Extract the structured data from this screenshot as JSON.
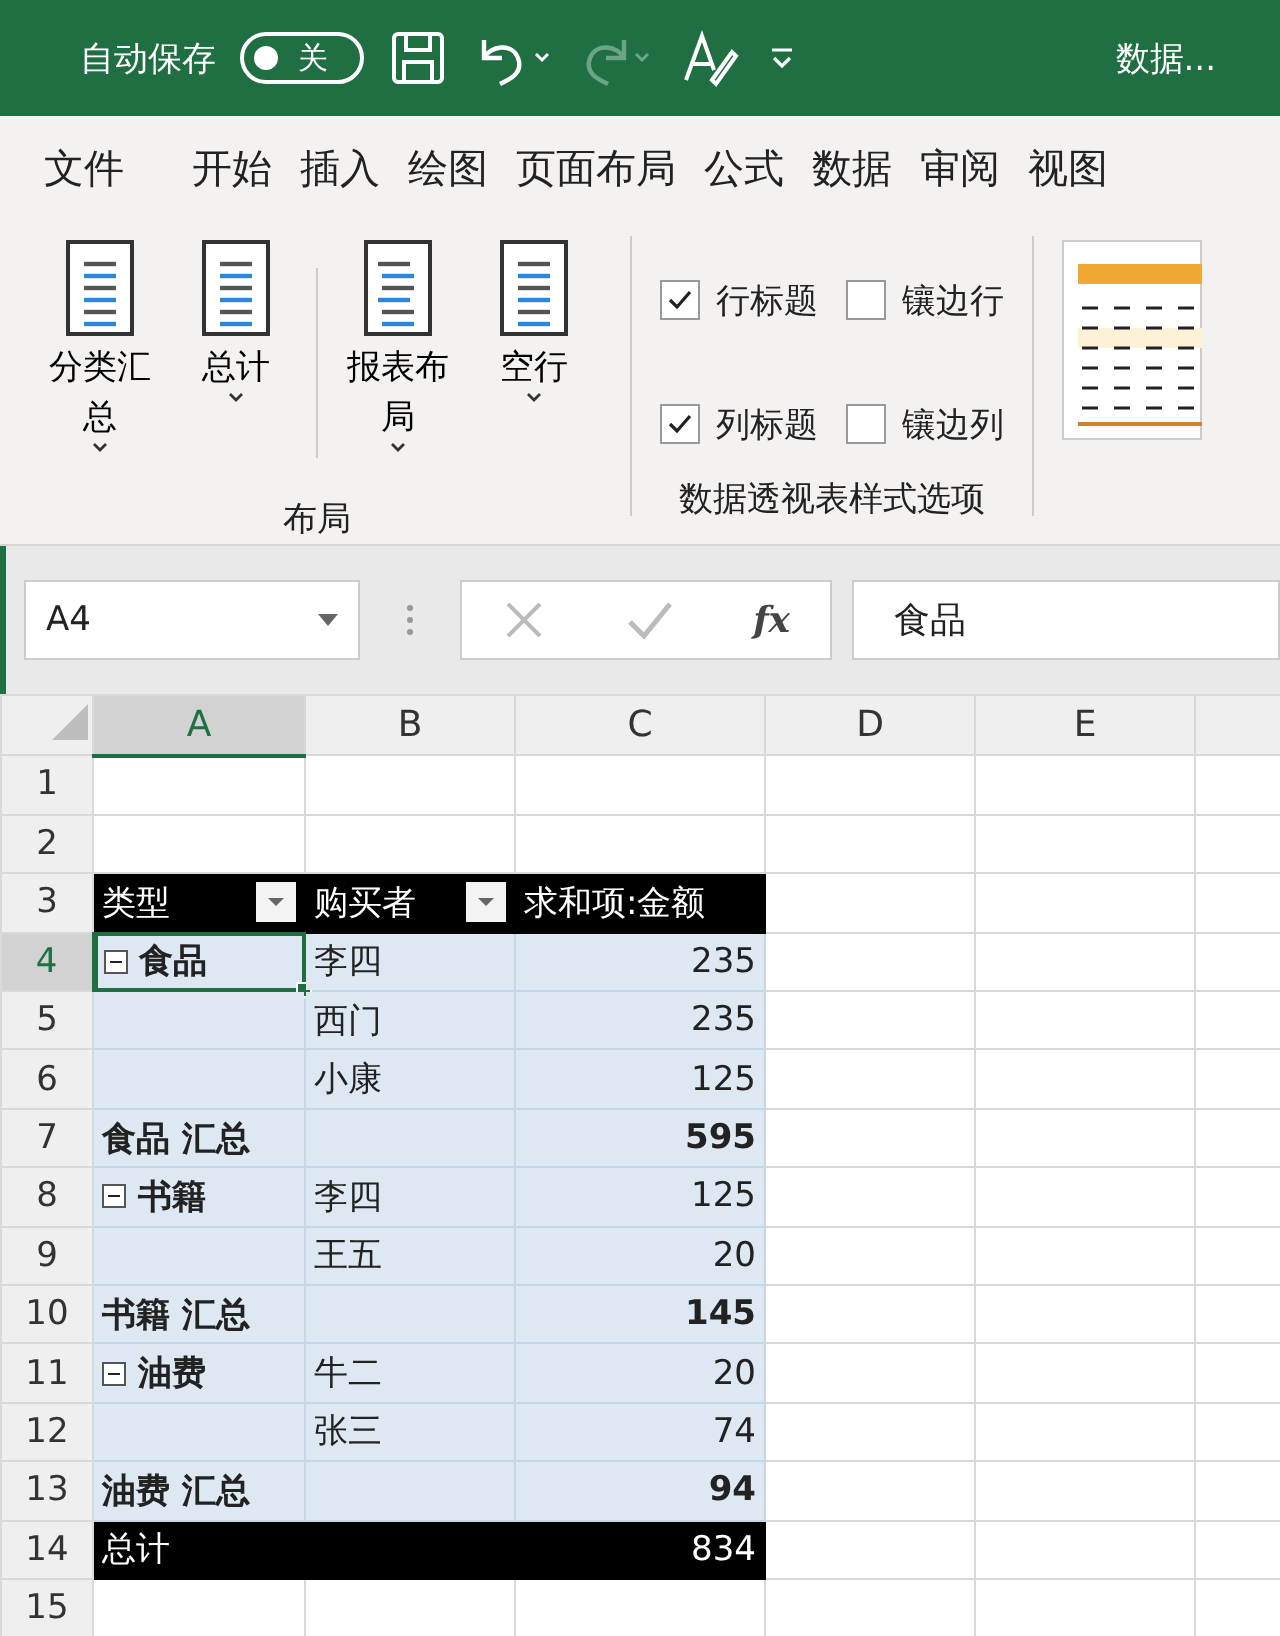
{
  "title_bar": {
    "autosave_label": "自动保存",
    "autosave_toggle": {
      "label": "关",
      "on": false
    },
    "document_title": "数据..."
  },
  "menu_tabs": [
    "文件",
    "开始",
    "插入",
    "绘图",
    "页面布局",
    "公式",
    "数据",
    "审阅",
    "视图"
  ],
  "ribbon": {
    "layout_group": {
      "label": "布局",
      "buttons": [
        {
          "label": "分类汇总"
        },
        {
          "label": "总计"
        },
        {
          "label": "报表布局"
        },
        {
          "label": "空行"
        }
      ]
    },
    "style_options_group": {
      "label": "数据透视表样式选项",
      "options": [
        {
          "label": "行标题",
          "checked": true
        },
        {
          "label": "镶边行",
          "checked": false
        },
        {
          "label": "列标题",
          "checked": true
        },
        {
          "label": "镶边列",
          "checked": false
        }
      ]
    }
  },
  "formula_bar": {
    "name_box": "A4",
    "function_symbol": "fx",
    "formula": "食品"
  },
  "grid": {
    "columns": [
      {
        "letter": "A",
        "selected": true
      },
      {
        "letter": "B",
        "selected": false
      },
      {
        "letter": "C",
        "selected": false
      },
      {
        "letter": "D",
        "selected": false
      },
      {
        "letter": "E",
        "selected": false
      }
    ],
    "rows": [
      {
        "number": "1",
        "selected": false,
        "kind": "blank",
        "cells": []
      },
      {
        "number": "2",
        "selected": false,
        "kind": "blank",
        "cells": []
      },
      {
        "number": "3",
        "selected": false,
        "kind": "header",
        "cells": [
          "类型",
          "购买者",
          "求和项:金额"
        ]
      },
      {
        "number": "4",
        "selected": true,
        "kind": "group",
        "expanded": true,
        "cells": [
          "食品",
          "李四",
          "235"
        ]
      },
      {
        "number": "5",
        "selected": false,
        "kind": "item",
        "cells": [
          "",
          "西门",
          "235"
        ]
      },
      {
        "number": "6",
        "selected": false,
        "kind": "item",
        "cells": [
          "",
          "小康",
          "125"
        ]
      },
      {
        "number": "7",
        "selected": false,
        "kind": "subtotal",
        "cells": [
          "食品 汇总",
          "",
          "595"
        ]
      },
      {
        "number": "8",
        "selected": false,
        "kind": "group",
        "expanded": true,
        "cells": [
          "书籍",
          "李四",
          "125"
        ]
      },
      {
        "number": "9",
        "selected": false,
        "kind": "item",
        "cells": [
          "",
          "王五",
          "20"
        ]
      },
      {
        "number": "10",
        "selected": false,
        "kind": "subtotal",
        "cells": [
          "书籍 汇总",
          "",
          "145"
        ]
      },
      {
        "number": "11",
        "selected": false,
        "kind": "group",
        "expanded": true,
        "cells": [
          "油费",
          "牛二",
          "20"
        ]
      },
      {
        "number": "12",
        "selected": false,
        "kind": "item",
        "cells": [
          "",
          "张三",
          "74"
        ]
      },
      {
        "number": "13",
        "selected": false,
        "kind": "subtotal",
        "cells": [
          "油费 汇总",
          "",
          "94"
        ]
      },
      {
        "number": "14",
        "selected": false,
        "kind": "total",
        "cells": [
          "总计",
          "",
          "834"
        ]
      },
      {
        "number": "15",
        "selected": false,
        "kind": "blank",
        "cells": []
      }
    ]
  }
}
